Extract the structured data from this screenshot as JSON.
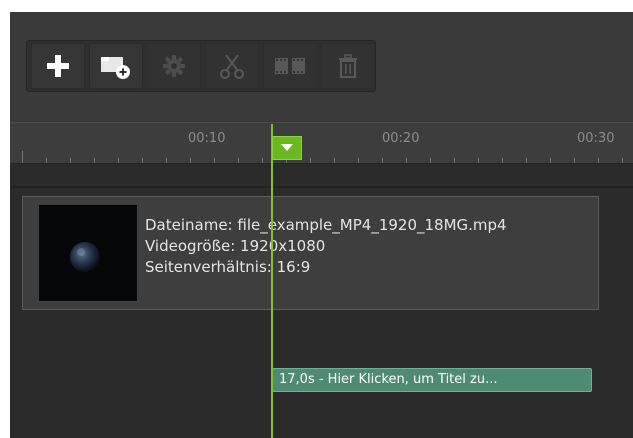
{
  "toolbar": {
    "buttons": [
      {
        "icon": "plus-icon",
        "enabled": true
      },
      {
        "icon": "add-media-icon",
        "enabled": true
      },
      {
        "icon": "gear-icon",
        "enabled": false
      },
      {
        "icon": "scissors-icon",
        "enabled": false
      },
      {
        "icon": "film-strip-icon",
        "enabled": false
      },
      {
        "icon": "trash-icon",
        "enabled": false
      }
    ]
  },
  "timeline": {
    "ticks": [
      "00:10",
      "00:20",
      "00:30"
    ]
  },
  "clip": {
    "filename_line": "Dateiname: file_example_MP4_1920_18MG.mp4",
    "size_line": "Videogröße: 1920x1080",
    "ratio_line": "Seitenverhältnis: 16:9"
  },
  "title_clip": {
    "label": "17,0s - Hier Klicken, um Titel zu..."
  },
  "colors": {
    "background": "#3a3a3a",
    "playhead": "#7cc52e",
    "title_clip": "#4f8a73"
  }
}
